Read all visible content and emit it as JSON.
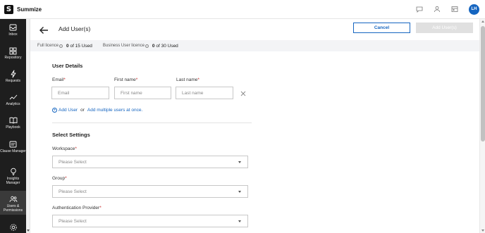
{
  "app": {
    "logo_letter": "S",
    "name": "Summize"
  },
  "topbar": {
    "icons": [
      "chat-icon",
      "user-icon",
      "calendar-icon"
    ],
    "avatar_initials": "LH"
  },
  "sidebar": {
    "items": [
      {
        "label": "Inbox",
        "icon": "inbox-icon"
      },
      {
        "label": "Repository",
        "icon": "grid-icon"
      },
      {
        "label": "Requests",
        "icon": "lightning-icon"
      },
      {
        "label": "Analytics",
        "icon": "trend-icon"
      },
      {
        "label": "Playbook",
        "icon": "book-icon"
      },
      {
        "label": "Clause Manager",
        "icon": "clause-icon"
      },
      {
        "label": "Insights Manager",
        "icon": "bulb-icon"
      },
      {
        "label": "Users & Permissions",
        "icon": "users-icon"
      }
    ],
    "active_index": 7
  },
  "header": {
    "title": "Add User(s)",
    "cancel_label": "Cancel",
    "add_label": "Add User(s)"
  },
  "licences": [
    {
      "label": "Full licence",
      "used": "0",
      "total": "of 15 Used"
    },
    {
      "label": "Business User licence",
      "used": "0",
      "total": "of 30 Used"
    }
  ],
  "user_details": {
    "title": "User Details",
    "email": {
      "label": "Email",
      "placeholder": "Email"
    },
    "first_name": {
      "label": "First name",
      "placeholder": "First name"
    },
    "last_name": {
      "label": "Last name",
      "placeholder": "Last name"
    },
    "add_user_link": "Add User",
    "or_text": "or",
    "add_multiple_link": "Add multiple users at once."
  },
  "settings": {
    "title": "Select Settings",
    "workspace": {
      "label": "Workspace",
      "value": "Please Select"
    },
    "group": {
      "label": "Group",
      "value": "Please Select"
    },
    "auth": {
      "label": "Authentication Provider",
      "value": "Please Select"
    }
  },
  "colors": {
    "primary": "#1565c0",
    "sidebar": "#1e1e1e",
    "required": "#c62828"
  }
}
